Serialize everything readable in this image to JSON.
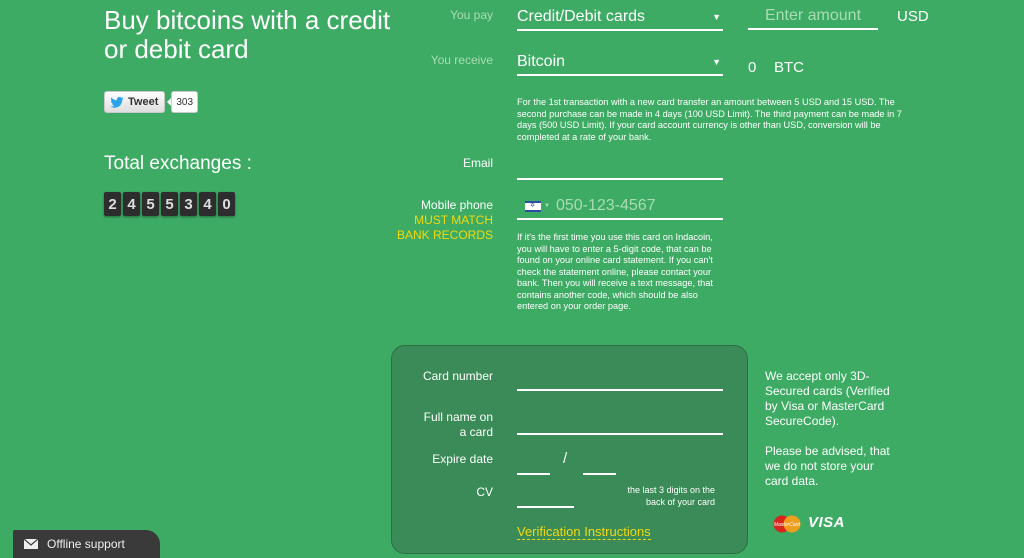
{
  "header": {
    "title": "Buy bitcoins with a credit or debit card"
  },
  "social": {
    "tweet_label": "Tweet",
    "tweet_count": "303"
  },
  "stats": {
    "total_label": "Total exchanges :",
    "digits": [
      "2",
      "4",
      "5",
      "5",
      "3",
      "4",
      "0"
    ]
  },
  "exchange": {
    "pay_label": "You pay",
    "pay_value": "Credit/Debit cards",
    "amount_placeholder": "Enter amount",
    "amount_currency": "USD",
    "receive_label": "You receive",
    "receive_value": "Bitcoin",
    "receive_amount": "0",
    "receive_currency": "BTC",
    "notice": "For the 1st transaction with a new card transfer an amount between 5 USD and 15 USD. The second purchase can be made in 4 days (100 USD Limit). The third payment can be made in 7 days (500 USD Limit). If your card account currency is other than USD, conversion will be completed at a rate of your bank."
  },
  "contact": {
    "email_label": "Email",
    "email_value": "",
    "phone_label": "Mobile phone",
    "phone_warning_1": "MUST MATCH",
    "phone_warning_2": "BANK RECORDS",
    "phone_placeholder": "050-123-4567",
    "phone_country_icon": "israel-flag-icon",
    "phone_notice": "If it's the first time you use this card on Indacoin, you will have to enter a 5-digit code, that can be found on your online card statement. If you can't check the statement online, please contact your bank. Then you will receive a text message, that contains another code, which should be also entered on your order page."
  },
  "card": {
    "number_label": "Card number",
    "name_label_1": "Full name on",
    "name_label_2": "a card",
    "expire_label": "Expire date",
    "expire_separator": "/",
    "cv_label": "CV",
    "cv_hint_1": "the last 3 digits on the",
    "cv_hint_2": "back of your card",
    "verification_link": "Verification Instructions"
  },
  "side_info": {
    "secure_text": "We accept only 3D-Secured cards (Verified by Visa or MasterCard SecureCode).",
    "privacy_text": "Please be advised, that we do not store your card data.",
    "mastercard_label": "MasterCard",
    "visa_label": "VISA"
  },
  "support": {
    "label": "Offline support"
  },
  "colors": {
    "background": "#3dab63",
    "card_panel": "#3a8b57",
    "accent_yellow": "#f2d90d",
    "counter_digit": "#2d2d2d"
  }
}
